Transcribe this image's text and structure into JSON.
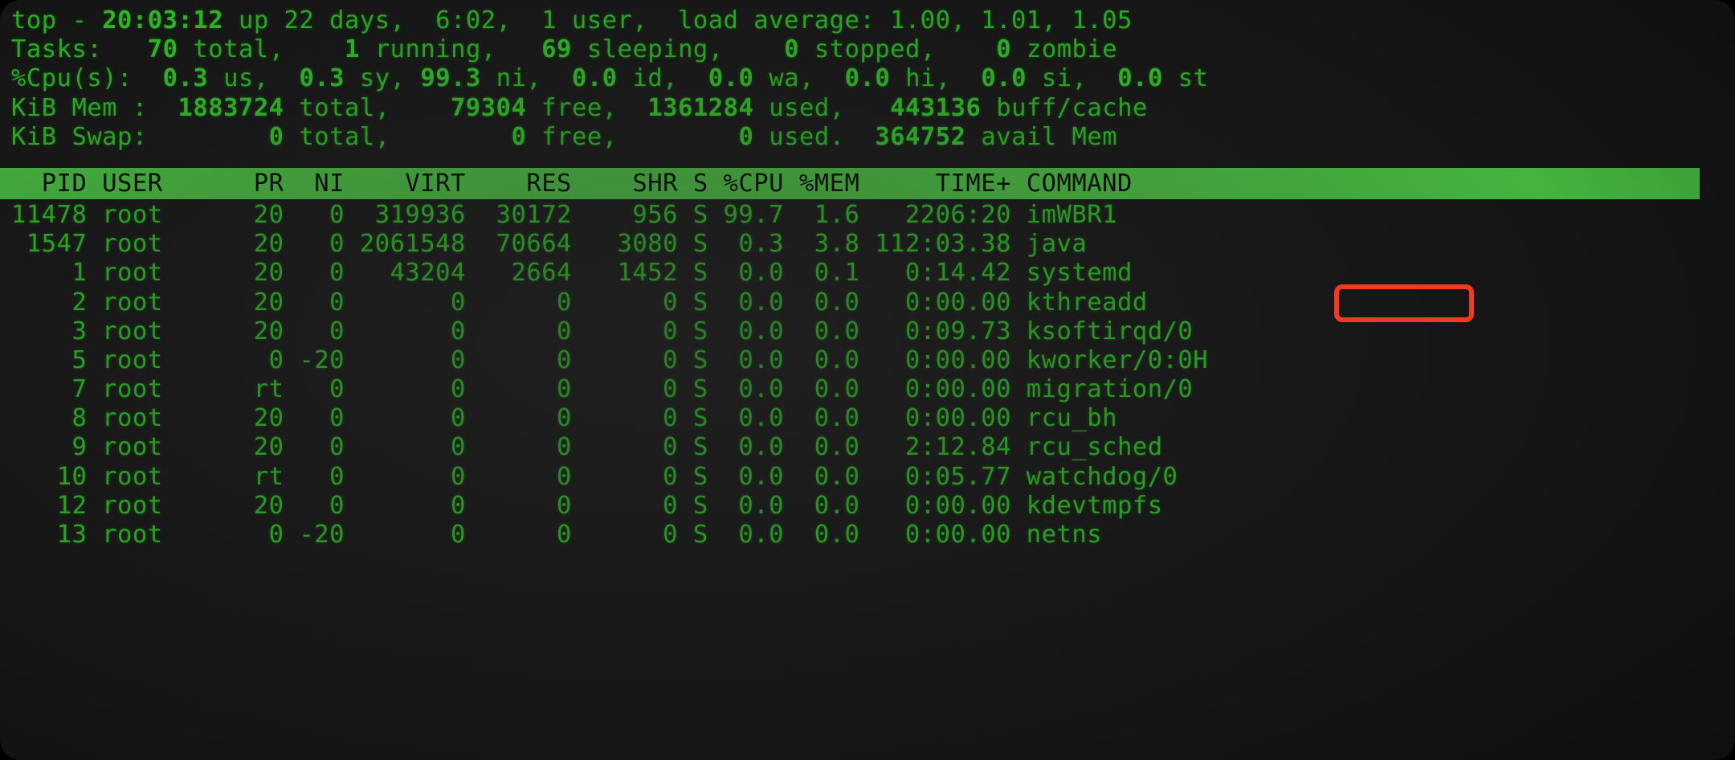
{
  "terminal": {
    "colors": {
      "background": "#151515",
      "text_green": "#2fe326",
      "bold_green": "#35f02a",
      "header_bar_bg": "#55e84b",
      "header_bar_fg": "#050505",
      "annotation_red": "#f4391c"
    },
    "summary": {
      "line1": {
        "label": "top - ",
        "time": "20:03:12",
        "uptime_text": " up 22 days,  6:02,  1 user,  load average: 1.00, 1.01, 1.05",
        "full": "top - 20:03:12 up 22 days,  6:02,  1 user,  load average: 1.00, 1.01, 1.05"
      },
      "tasks": {
        "label": "Tasks:",
        "total": "70",
        "total_label": "total,",
        "running": "1",
        "running_label": "running,",
        "sleeping": "69",
        "sleeping_label": "sleeping,",
        "stopped": "0",
        "stopped_label": "stopped,",
        "zombie": "0",
        "zombie_label": "zombie"
      },
      "cpu": {
        "label": "%Cpu(s):",
        "us": "0.3",
        "us_label": "us,",
        "sy": "0.3",
        "sy_label": "sy,",
        "ni": "99.3",
        "ni_label": "ni,",
        "id": "0.0",
        "id_label": "id,",
        "wa": "0.0",
        "wa_label": "wa,",
        "hi": "0.0",
        "hi_label": "hi,",
        "si": "0.0",
        "si_label": "si,",
        "st": "0.0",
        "st_label": "st"
      },
      "mem": {
        "label": "KiB Mem :",
        "total": "1883724",
        "total_label": "total,",
        "free": "79304",
        "free_label": "free,",
        "used": "1361284",
        "used_label": "used,",
        "buff_cache": "443136",
        "buff_cache_label": "buff/cache"
      },
      "swap": {
        "label": "KiB Swap:",
        "total": "0",
        "total_label": "total,",
        "free": "0",
        "free_label": "free,",
        "used": "0",
        "used_label": "used.",
        "avail": "364752",
        "avail_label": "avail Mem"
      }
    },
    "table": {
      "headers": [
        "PID",
        "USER",
        "PR",
        "NI",
        "VIRT",
        "RES",
        "SHR",
        "S",
        "%CPU",
        "%MEM",
        "TIME+",
        "COMMAND"
      ],
      "header_line": "  PID USER      PR  NI    VIRT    RES    SHR S %CPU %MEM     TIME+ COMMAND",
      "rows": [
        {
          "pid": "11478",
          "user": "root",
          "pr": "20",
          "ni": "0",
          "virt": "319936",
          "res": "30172",
          "shr": "956",
          "s": "S",
          "cpu": "99.7",
          "mem": "1.6",
          "time": "2206:20",
          "command": "imWBR1",
          "line": "11478 root      20   0  319936  30172    956 S 99.7  1.6   2206:20 imWBR1"
        },
        {
          "pid": "1547",
          "user": "root",
          "pr": "20",
          "ni": "0",
          "virt": "2061548",
          "res": "70664",
          "shr": "3080",
          "s": "S",
          "cpu": "0.3",
          "mem": "3.8",
          "time": "112:03.38",
          "command": "java",
          "line": " 1547 root      20   0 2061548  70664   3080 S  0.3  3.8 112:03.38 java"
        },
        {
          "pid": "1",
          "user": "root",
          "pr": "20",
          "ni": "0",
          "virt": "43204",
          "res": "2664",
          "shr": "1452",
          "s": "S",
          "cpu": "0.0",
          "mem": "0.1",
          "time": "0:14.42",
          "command": "systemd",
          "line": "    1 root      20   0   43204   2664   1452 S  0.0  0.1   0:14.42 systemd"
        },
        {
          "pid": "2",
          "user": "root",
          "pr": "20",
          "ni": "0",
          "virt": "0",
          "res": "0",
          "shr": "0",
          "s": "S",
          "cpu": "0.0",
          "mem": "0.0",
          "time": "0:00.00",
          "command": "kthreadd",
          "line": "    2 root      20   0       0      0      0 S  0.0  0.0   0:00.00 kthreadd"
        },
        {
          "pid": "3",
          "user": "root",
          "pr": "20",
          "ni": "0",
          "virt": "0",
          "res": "0",
          "shr": "0",
          "s": "S",
          "cpu": "0.0",
          "mem": "0.0",
          "time": "0:09.73",
          "command": "ksoftirqd/0",
          "line": "    3 root      20   0       0      0      0 S  0.0  0.0   0:09.73 ksoftirqd/0"
        },
        {
          "pid": "5",
          "user": "root",
          "pr": "0",
          "ni": "-20",
          "virt": "0",
          "res": "0",
          "shr": "0",
          "s": "S",
          "cpu": "0.0",
          "mem": "0.0",
          "time": "0:00.00",
          "command": "kworker/0:0H",
          "line": "    5 root       0 -20       0      0      0 S  0.0  0.0   0:00.00 kworker/0:0H"
        },
        {
          "pid": "7",
          "user": "root",
          "pr": "rt",
          "ni": "0",
          "virt": "0",
          "res": "0",
          "shr": "0",
          "s": "S",
          "cpu": "0.0",
          "mem": "0.0",
          "time": "0:00.00",
          "command": "migration/0",
          "line": "    7 root      rt   0       0      0      0 S  0.0  0.0   0:00.00 migration/0"
        },
        {
          "pid": "8",
          "user": "root",
          "pr": "20",
          "ni": "0",
          "virt": "0",
          "res": "0",
          "shr": "0",
          "s": "S",
          "cpu": "0.0",
          "mem": "0.0",
          "time": "0:00.00",
          "command": "rcu_bh",
          "line": "    8 root      20   0       0      0      0 S  0.0  0.0   0:00.00 rcu_bh"
        },
        {
          "pid": "9",
          "user": "root",
          "pr": "20",
          "ni": "0",
          "virt": "0",
          "res": "0",
          "shr": "0",
          "s": "S",
          "cpu": "0.0",
          "mem": "0.0",
          "time": "2:12.84",
          "command": "rcu_sched",
          "line": "    9 root      20   0       0      0      0 S  0.0  0.0   2:12.84 rcu_sched"
        },
        {
          "pid": "10",
          "user": "root",
          "pr": "rt",
          "ni": "0",
          "virt": "0",
          "res": "0",
          "shr": "0",
          "s": "S",
          "cpu": "0.0",
          "mem": "0.0",
          "time": "0:05.77",
          "command": "watchdog/0",
          "line": "   10 root      rt   0       0      0      0 S  0.0  0.0   0:05.77 watchdog/0"
        },
        {
          "pid": "12",
          "user": "root",
          "pr": "20",
          "ni": "0",
          "virt": "0",
          "res": "0",
          "shr": "0",
          "s": "S",
          "cpu": "0.0",
          "mem": "0.0",
          "time": "0:00.00",
          "command": "kdevtmpfs",
          "line": "   12 root      20   0       0      0      0 S  0.0  0.0   0:00.00 kdevtmpfs"
        },
        {
          "pid": "13",
          "user": "root",
          "pr": "0",
          "ni": "-20",
          "virt": "0",
          "res": "0",
          "shr": "0",
          "s": "S",
          "cpu": "0.0",
          "mem": "0.0",
          "time": "0:00.00",
          "command": "netns",
          "line": "   13 root       0 -20       0      0      0 S  0.0  0.0   0:00.00 netns"
        }
      ]
    },
    "annotation": {
      "target_text": "imWBR1",
      "shape": "rounded-rectangle",
      "color": "#f4391c"
    }
  }
}
